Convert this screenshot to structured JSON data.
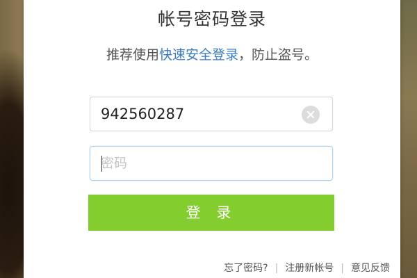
{
  "login": {
    "title": "帐号密码登录",
    "subtitle_before": "推荐使用",
    "subtitle_link": "快速安全登录",
    "subtitle_after": "，防止盗号。",
    "account_value": "942560287",
    "password_placeholder": "密码",
    "login_button_label": "登 录"
  },
  "footer": {
    "forgot_password": "忘了密码?",
    "separator": "|",
    "register": "注册新帐号",
    "feedback": "意见反馈"
  },
  "colors": {
    "accent_green": "#84cd2f",
    "link_blue": "#3a7bbf"
  },
  "icons": {
    "clear": "clear-icon"
  }
}
